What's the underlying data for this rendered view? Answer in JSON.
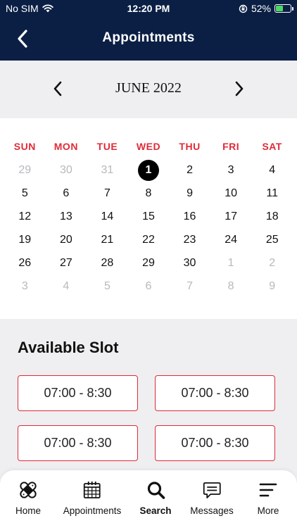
{
  "status_bar": {
    "carrier": "No SIM",
    "time": "12:20 PM",
    "battery_percent": "52%",
    "battery_level": 0.52
  },
  "header": {
    "title": "Appointments",
    "back_icon": "chevron-left-icon"
  },
  "calendar": {
    "month_label": "JUNE 2022",
    "weekdays": [
      "SUN",
      "MON",
      "TUE",
      "WED",
      "THU",
      "FRI",
      "SAT"
    ],
    "days": [
      {
        "label": "29",
        "muted": true
      },
      {
        "label": "30",
        "muted": true
      },
      {
        "label": "31",
        "muted": true
      },
      {
        "label": "1",
        "selected": true
      },
      {
        "label": "2"
      },
      {
        "label": "3"
      },
      {
        "label": "4"
      },
      {
        "label": "5"
      },
      {
        "label": "6"
      },
      {
        "label": "7"
      },
      {
        "label": "8"
      },
      {
        "label": "9"
      },
      {
        "label": "10"
      },
      {
        "label": "11"
      },
      {
        "label": "12"
      },
      {
        "label": "13"
      },
      {
        "label": "14"
      },
      {
        "label": "15"
      },
      {
        "label": "16"
      },
      {
        "label": "17"
      },
      {
        "label": "18"
      },
      {
        "label": "19"
      },
      {
        "label": "20"
      },
      {
        "label": "21"
      },
      {
        "label": "22"
      },
      {
        "label": "23"
      },
      {
        "label": "24"
      },
      {
        "label": "25"
      },
      {
        "label": "26"
      },
      {
        "label": "27"
      },
      {
        "label": "28"
      },
      {
        "label": "29"
      },
      {
        "label": "30"
      },
      {
        "label": "1",
        "muted": true
      },
      {
        "label": "2",
        "muted": true
      },
      {
        "label": "3",
        "muted": true
      },
      {
        "label": "4",
        "muted": true
      },
      {
        "label": "5",
        "muted": true
      },
      {
        "label": "6",
        "muted": true
      },
      {
        "label": "7",
        "muted": true
      },
      {
        "label": "8",
        "muted": true
      },
      {
        "label": "9",
        "muted": true
      }
    ]
  },
  "slots": {
    "title": "Available Slot",
    "items": [
      "07:00 - 8:30",
      "07:00 - 8:30",
      "07:00 - 8:30",
      "07:00 - 8:30"
    ]
  },
  "tab_bar": {
    "items": [
      {
        "label": "Home",
        "icon": "bandage-icon"
      },
      {
        "label": "Appointments",
        "icon": "calendar-icon"
      },
      {
        "label": "Search",
        "icon": "search-icon",
        "active": true
      },
      {
        "label": "Messages",
        "icon": "message-icon"
      },
      {
        "label": "More",
        "icon": "menu-icon"
      }
    ]
  },
  "colors": {
    "nav_background": "#0b1f45",
    "accent_red": "#e02b37",
    "section_gray": "#efeff1",
    "muted_day": "#b8b8bd"
  }
}
